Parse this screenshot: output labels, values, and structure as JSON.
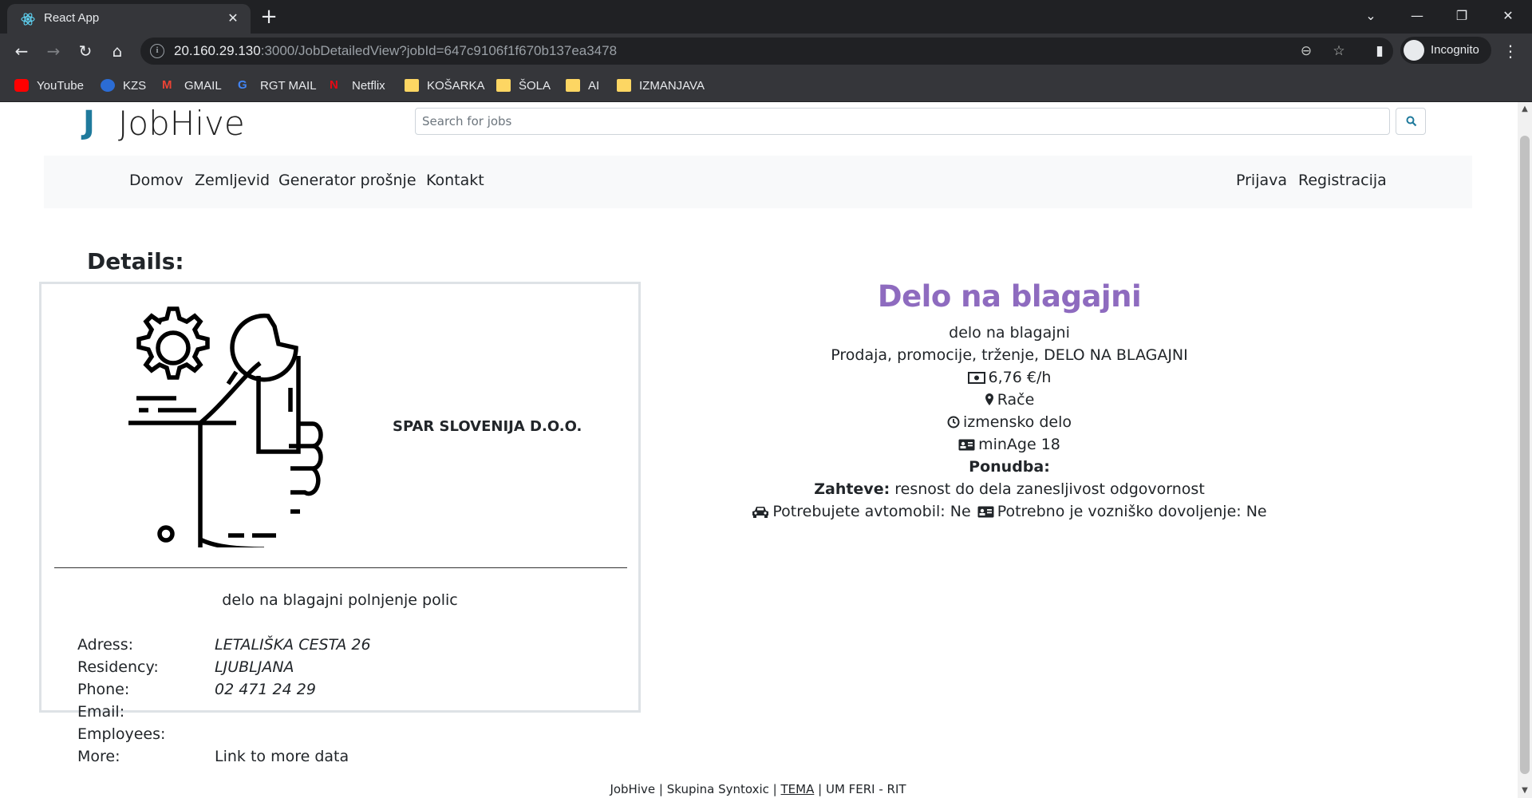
{
  "browser": {
    "tab_title": "React App",
    "url_host": "20.160.29.130",
    "url_rest": ":3000/JobDetailedView?jobId=647c9106f1f670b137ea3478",
    "profile_label": "Incognito",
    "bookmarks": [
      {
        "label": "YouTube",
        "icon": "youtube-icon"
      },
      {
        "label": "KZS",
        "icon": "kzs-icon"
      },
      {
        "label": "GMAIL",
        "icon": "gmail-icon"
      },
      {
        "label": "RGT MAIL",
        "icon": "google-icon"
      },
      {
        "label": "Netflix",
        "icon": "netflix-icon"
      },
      {
        "label": "KOŠARKA",
        "icon": "folder-icon"
      },
      {
        "label": "ŠOLA",
        "icon": "folder-icon"
      },
      {
        "label": "AI",
        "icon": "folder-icon"
      },
      {
        "label": "IZMANJAVA",
        "icon": "folder-icon"
      }
    ]
  },
  "header": {
    "logo_letter": "J",
    "logo_text": "JobHive",
    "search_placeholder": "Search for jobs"
  },
  "nav": {
    "left": [
      "Domov",
      "Zemljevid",
      "Generator prošnje",
      "Kontakt"
    ],
    "right": [
      "Prijava",
      "Registracija"
    ]
  },
  "details": {
    "heading": "Details:",
    "company": "SPAR SLOVENIJA D.O.O.",
    "description": "delo na blagajni polnjenje polic",
    "labels": {
      "address": "Adress:",
      "residency": "Residency:",
      "phone": "Phone:",
      "email": "Email:",
      "employees": "Employees:",
      "more": "More:"
    },
    "values": {
      "address": "LETALIŠKA CESTA 26",
      "residency": "LJUBLJANA",
      "phone": "02 471 24 29",
      "email": "",
      "employees": "",
      "more": "Link to more data"
    }
  },
  "job": {
    "title": "Delo na blagajni",
    "subtitle": "delo na blagajni",
    "categories": "Prodaja, promocije, trženje, DELO NA BLAGAJNI",
    "pay": "6,76 €/h",
    "location": "Rače",
    "schedule": "izmensko delo",
    "min_age": "minAge 18",
    "offer_label": "Ponudba:",
    "requirements_label": "Zahteve:",
    "requirements": "resnost do dela zanesljivost odgovornost",
    "car_text": "Potrebujete avtomobil: Ne",
    "license_text": "Potrebno je vozniško dovoljenje: Ne"
  },
  "footer": {
    "before": "JobHive | Skupina Syntoxic |",
    "link": "TEMA",
    "after": "| UM FERI - RIT"
  }
}
